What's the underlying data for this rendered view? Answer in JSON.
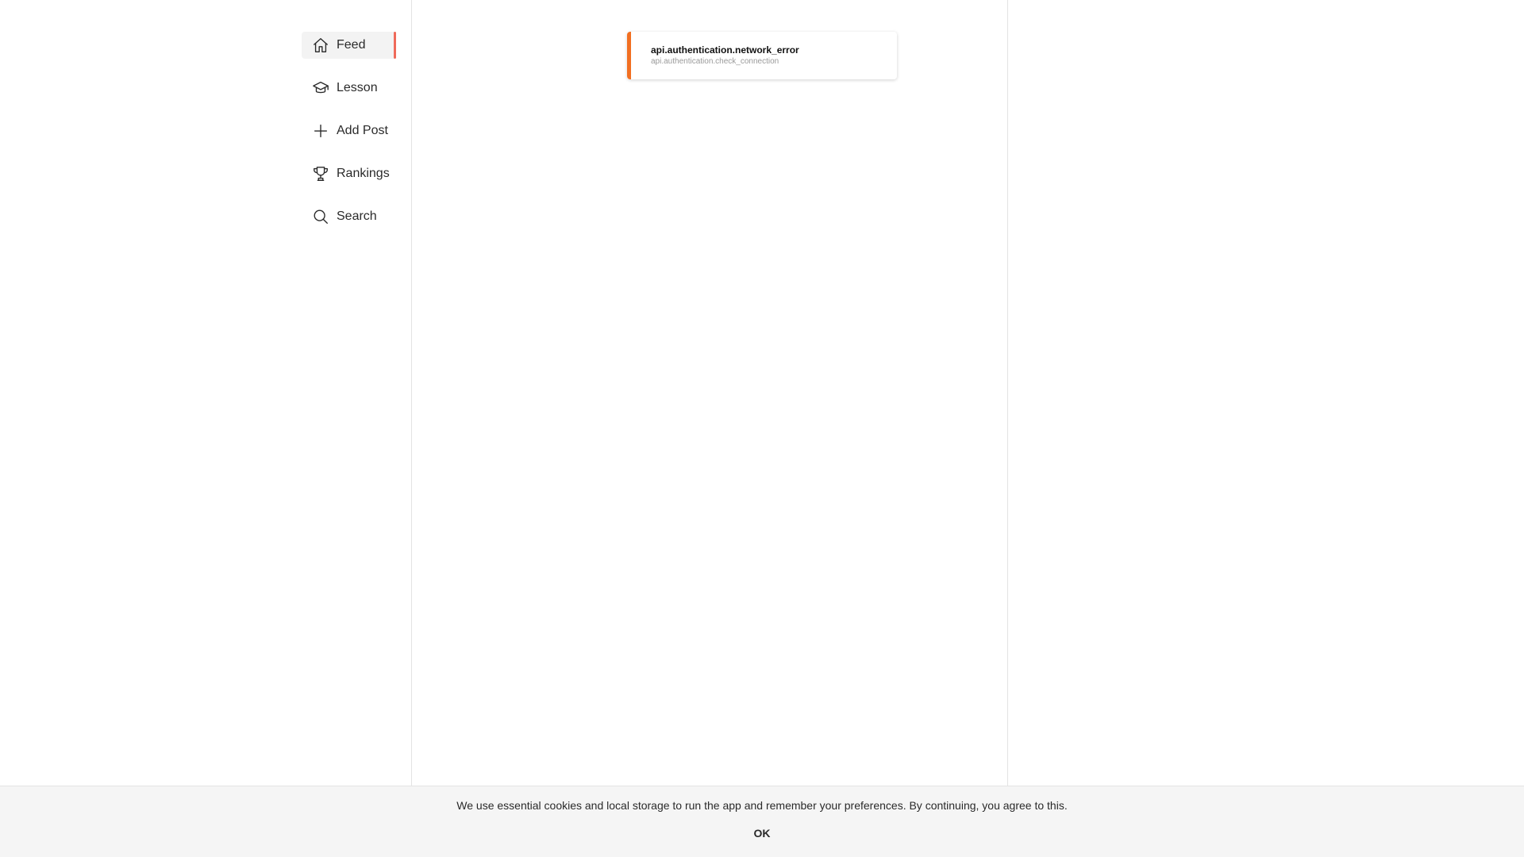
{
  "sidebar": {
    "items": [
      {
        "label": "Feed",
        "icon": "home-icon",
        "active": true
      },
      {
        "label": "Lesson",
        "icon": "graduation-cap-icon",
        "active": false
      },
      {
        "label": "Add Post",
        "icon": "plus-icon",
        "active": false
      },
      {
        "label": "Rankings",
        "icon": "trophy-icon",
        "active": false
      },
      {
        "label": "Search",
        "icon": "search-icon",
        "active": false
      }
    ],
    "active_indicator_color": "#ef6a5a"
  },
  "toast": {
    "title": "api.authentication.network_error",
    "message": "api.authentication.check_connection",
    "accent_color": "#f26f21"
  },
  "cookie_banner": {
    "text": "We use essential cookies and local storage to run the app and remember your preferences. By continuing, you agree to this.",
    "ok_label": "OK"
  }
}
